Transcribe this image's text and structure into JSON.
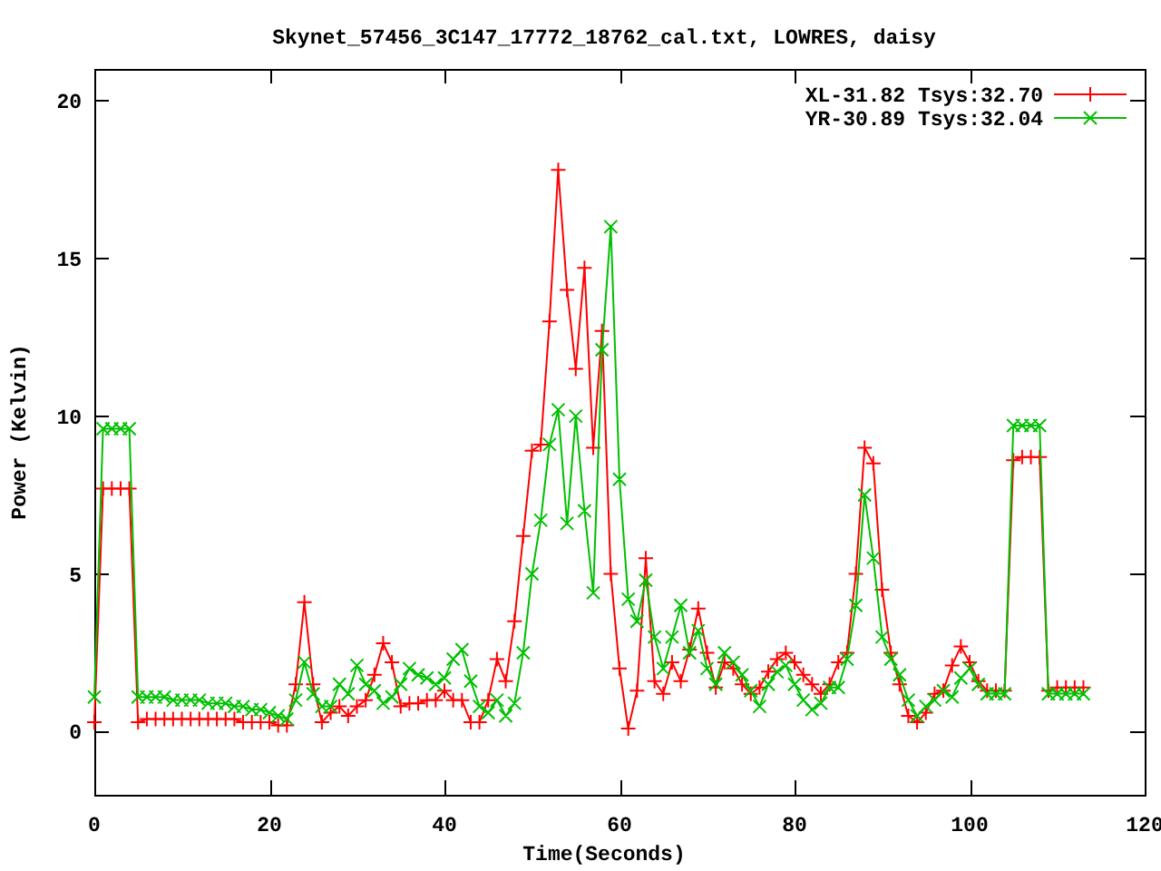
{
  "chart_data": {
    "type": "line",
    "title": "Skynet_57456_3C147_17772_18762_cal.txt, LOWRES, daisy",
    "xlabel": "Time(Seconds)",
    "ylabel": "Power (Kelvin)",
    "x": [
      0,
      1,
      2,
      3,
      4,
      5,
      6,
      7,
      8,
      9,
      10,
      11,
      12,
      13,
      14,
      15,
      16,
      17,
      18,
      19,
      20,
      21,
      22,
      23,
      24,
      25,
      26,
      27,
      28,
      29,
      30,
      31,
      32,
      33,
      34,
      35,
      36,
      37,
      38,
      39,
      40,
      41,
      42,
      43,
      44,
      45,
      46,
      47,
      48,
      49,
      50,
      51,
      52,
      53,
      54,
      55,
      56,
      57,
      58,
      59,
      60,
      61,
      62,
      63,
      64,
      65,
      66,
      67,
      68,
      69,
      70,
      71,
      72,
      73,
      74,
      75,
      76,
      77,
      78,
      79,
      80,
      81,
      82,
      83,
      84,
      85,
      86,
      87,
      88,
      89,
      90,
      91,
      92,
      93,
      94,
      95,
      96,
      97,
      98,
      99,
      100,
      101,
      102,
      103,
      104,
      105,
      106,
      107,
      108,
      109,
      110,
      111,
      112,
      113
    ],
    "series": [
      {
        "name": "XL-31.82 Tsys:32.70",
        "color": "#ff0000",
        "marker": "plus",
        "values": [
          0.3,
          7.7,
          7.7,
          7.7,
          7.7,
          0.3,
          0.4,
          0.4,
          0.4,
          0.4,
          0.4,
          0.4,
          0.4,
          0.4,
          0.4,
          0.4,
          0.4,
          0.3,
          0.3,
          0.3,
          0.3,
          0.2,
          0.2,
          1.5,
          4.1,
          1.5,
          0.3,
          0.6,
          0.8,
          0.5,
          0.8,
          1.0,
          1.8,
          2.8,
          2.2,
          0.8,
          0.9,
          0.9,
          1.0,
          1.0,
          1.3,
          1.0,
          1.0,
          0.3,
          0.3,
          1.0,
          2.3,
          1.6,
          3.5,
          6.2,
          8.9,
          9.1,
          13,
          17.8,
          14,
          11.5,
          14.7,
          9,
          12.7,
          5,
          2,
          0.1,
          1.3,
          5.5,
          1.6,
          1.2,
          2.2,
          1.6,
          2.6,
          3.9,
          2.5,
          1.4,
          2.2,
          2.0,
          1.5,
          1.2,
          1.4,
          1.9,
          2.3,
          2.5,
          2.2,
          1.8,
          1.5,
          1.2,
          1.5,
          2.2,
          2.5,
          5,
          9,
          8.5,
          4.5,
          2.5,
          1.5,
          0.5,
          0.3,
          0.6,
          1.2,
          1.3,
          2.1,
          2.7,
          2.2,
          1.6,
          1.3,
          1.3,
          1.3,
          8.6,
          8.7,
          8.7,
          8.7,
          1.3,
          1.4,
          1.4,
          1.4,
          1.4
        ]
      },
      {
        "name": "YR-30.89 Tsys:32.04",
        "color": "#00c000",
        "marker": "cross",
        "values": [
          1.1,
          9.6,
          9.6,
          9.6,
          9.6,
          1.1,
          1.1,
          1.1,
          1.1,
          1.0,
          1.0,
          1.0,
          1.0,
          0.9,
          0.9,
          0.9,
          0.8,
          0.8,
          0.7,
          0.7,
          0.6,
          0.5,
          0.4,
          1.0,
          2.2,
          1.2,
          0.8,
          0.8,
          1.5,
          1.2,
          2.1,
          1.5,
          1.3,
          0.9,
          1.1,
          1.5,
          2.0,
          1.8,
          1.7,
          1.5,
          1.7,
          2.3,
          2.6,
          1.6,
          0.8,
          0.6,
          1.0,
          0.5,
          0.9,
          2.5,
          5,
          6.7,
          9.1,
          10.2,
          6.6,
          10,
          7,
          4.4,
          12.1,
          16,
          8,
          4.2,
          3.5,
          4.8,
          3.0,
          2.0,
          3.0,
          4.0,
          2.5,
          3.2,
          2.0,
          1.5,
          2.5,
          2.2,
          1.8,
          1.3,
          0.8,
          1.5,
          1.9,
          2.1,
          1.5,
          1.0,
          0.7,
          0.9,
          1.4,
          1.4,
          2.3,
          4,
          7.5,
          5.5,
          3,
          2.3,
          1.8,
          1.0,
          0.5,
          0.8,
          1.0,
          1.3,
          1.1,
          1.7,
          2.0,
          1.5,
          1.2,
          1.2,
          1.2,
          9.7,
          9.7,
          9.7,
          9.7,
          1.2,
          1.2,
          1.2,
          1.2,
          1.2
        ]
      }
    ],
    "legend": true,
    "xlim": [
      0,
      120
    ],
    "ylim": [
      -2,
      21
    ],
    "xticks": [
      0,
      20,
      40,
      60,
      80,
      100,
      120
    ],
    "yticks": [
      0,
      5,
      10,
      15,
      20
    ]
  }
}
